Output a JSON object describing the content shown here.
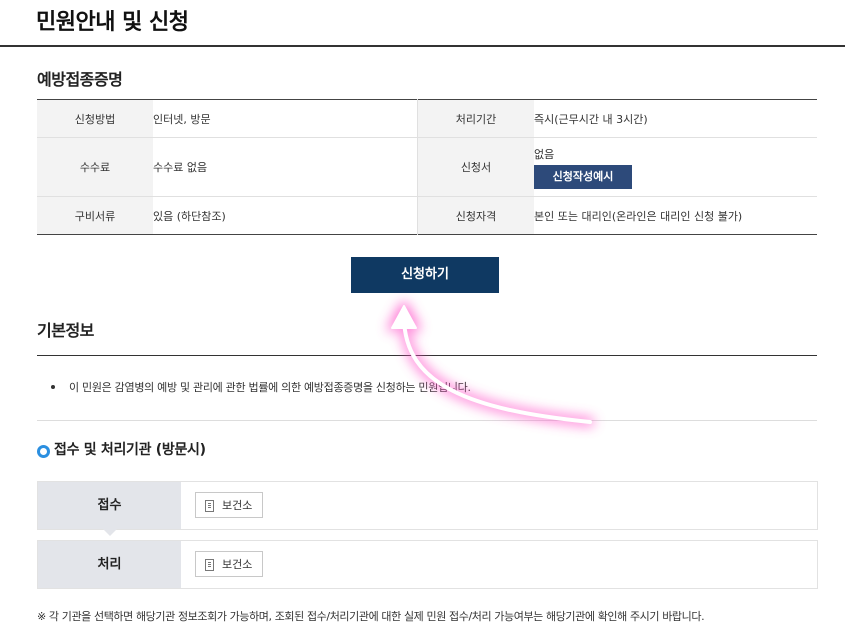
{
  "page": {
    "title": "민원안내 및 신청"
  },
  "service": {
    "name": "예방접종증명",
    "rows": [
      {
        "label1": "신청방법",
        "value1": "인터넷, 방문",
        "label2": "처리기간",
        "value2": "즉시(근무시간 내 3시간)"
      },
      {
        "label1": "수수료",
        "value1": "수수료 없음",
        "label2": "신청서",
        "value2": "없음",
        "form_button": "신청작성예시"
      },
      {
        "label1": "구비서류",
        "value1": "있음 (하단참조)",
        "label2": "신청자격",
        "value2": "본인 또는 대리인(온라인은 대리인 신청 불가)"
      }
    ]
  },
  "apply_button": "신청하기",
  "basic_info": {
    "title": "기본정보",
    "bullet": "이 민원은 감염병의 예방 및 관리에 관한 법률에 의한 예방접종증명을 신청하는 민원입니다."
  },
  "agencies": {
    "title": "접수 및 처리기관 (방문시)",
    "rows": [
      {
        "label": "접수",
        "button": "보건소"
      },
      {
        "label": "처리",
        "button": "보건소"
      }
    ]
  },
  "notice": "※ 각 기관을 선택하면 해당기관 정보조회가 가능하며, 조회된 접수/처리기관에 대한 실제 민원 접수/처리 가능여부는 해당기관에 확인해 주시기 바랍니다.",
  "colors": {
    "primary_button": "#0f3962",
    "form_button": "#2d4a7a",
    "accent": "#2b8fe0",
    "arrow": "#ff4fc8"
  },
  "icons": {
    "building": "building-icon",
    "circle": "circle-bullet-icon",
    "arrow": "pointer-arrow-annotation"
  }
}
